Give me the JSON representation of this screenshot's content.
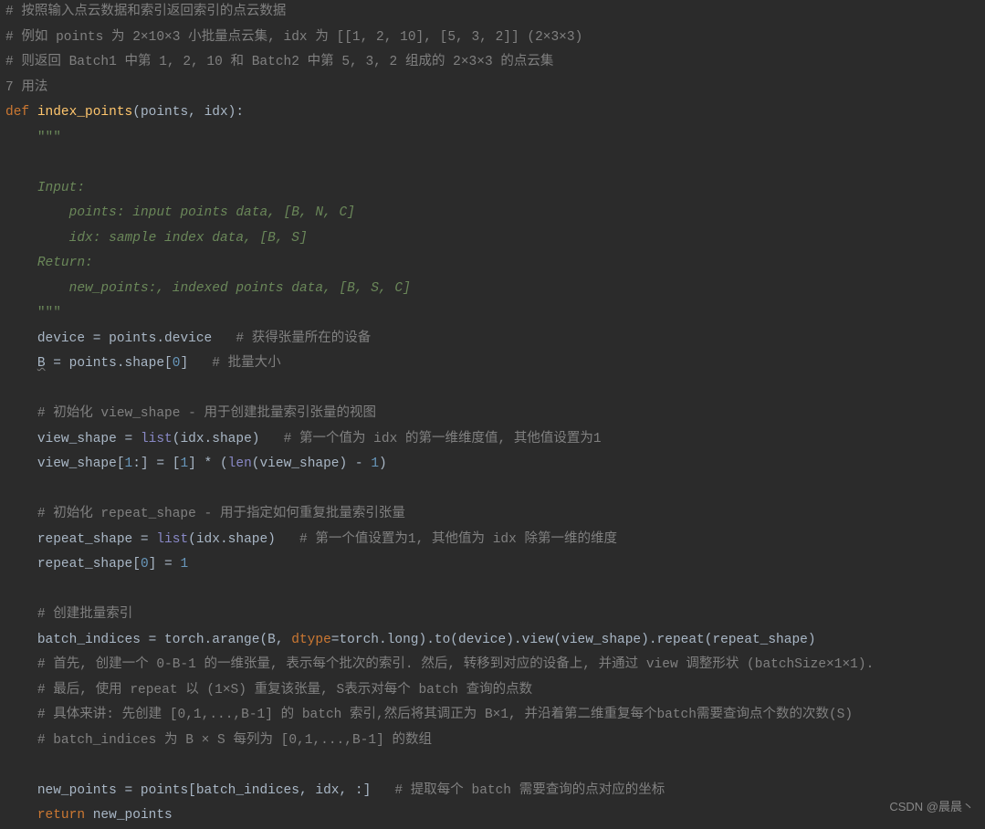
{
  "c1": "# 按照输入点云数据和索引返回索引的点云数据",
  "c2": "# 例如 points 为 2×10×3 小批量点云集, idx 为 [[1, 2, 10], [5, 3, 2]] (2×3×3)",
  "c3": "# 则返回 Batch1 中第 1, 2, 10 和 Batch2 中第 5, 3, 2 组成的 2×3×3 的点云集",
  "c4": "7 用法",
  "kw_def": "def",
  "fn_name": "index_points",
  "p_points": "points",
  "p_idx": "idx",
  "tq": "\"\"\"",
  "d_input": "Input:",
  "d_points": "points: input points data, [B, N, C]",
  "d_idx": "idx: sample index data, [B, S]",
  "d_return": "Return:",
  "d_new": "new_points:, indexed points data, [B, S, C]",
  "s_device1": "device = points.device",
  "c_device": "# 获得张量所在的设备",
  "s_B_lhs": "B",
  "s_B_rest": " = points.shape[",
  "n0": "0",
  "s_B_end": "]",
  "c_B": "# 批量大小",
  "c_vshead": "# 初始化 view_shape - 用于创建批量索引张量的视图",
  "s_vs1a": "view_shape = ",
  "bi_list": "list",
  "s_vs1b": "(idx.shape)",
  "c_vs1": "# 第一个值为 idx 的第一维维度值, 其他值设置为1",
  "s_vs2a": "view_shape[",
  "n1": "1",
  "s_vs2b": ":] = [",
  "s_vs2c": "] * (",
  "bi_len": "len",
  "s_vs2d": "(view_shape) - ",
  "s_vs2e": ")",
  "c_rshead": "# 初始化 repeat_shape - 用于指定如何重复批量索引张量",
  "s_rs1a": "repeat_shape = ",
  "s_rs1b": "(idx.shape)",
  "c_rs1": "# 第一个值设置为1, 其他值为 idx 除第一维的维度",
  "s_rs2a": "repeat_shape[",
  "s_rs2b": "] = ",
  "c_bihead": "# 创建批量索引",
  "s_bi_a": "batch_indices = torch.arange(B, ",
  "kw_dtype": "dtype",
  "s_bi_b": "=torch.long).to(device).view(view_shape).repeat(repeat_shape)",
  "c_bi1": "# 首先, 创建一个 0-B-1 的一维张量, 表示每个批次的索引. 然后, 转移到对应的设备上, 并通过 view 调整形状 (batchSize×1×1).",
  "c_bi2": "# 最后, 使用 repeat 以 (1×S) 重复该张量, S表示对每个 batch 查询的点数",
  "c_bi3": "# 具体来讲: 先创建 [0,1,...,B-1] 的 batch 索引,然后将其调正为 B×1, 并沿着第二维重复每个batch需要查询点个数的次数(S)",
  "c_bi4": "# batch_indices 为 B × S 每列为 [0,1,...,B-1] 的数组",
  "s_np": "new_points = points[batch_indices, idx, :]",
  "c_np": "# 提取每个 batch 需要查询的点对应的坐标",
  "kw_return": "return",
  "s_ret": " new_points",
  "watermark": "CSDN @晨晨丶"
}
